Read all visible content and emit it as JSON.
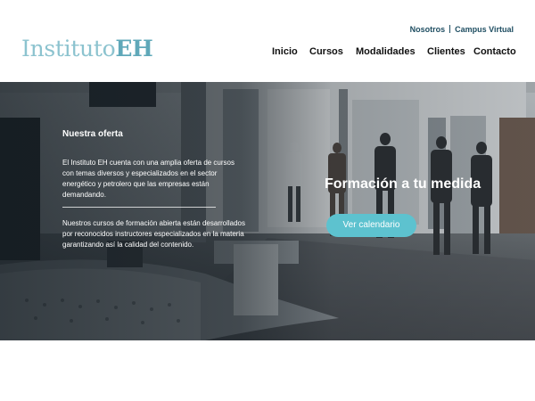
{
  "brand": {
    "logo_light": "Instituto",
    "logo_bold": "EH",
    "logo_color": "#8cc3cf",
    "logo_bold_color": "#5fa8b9"
  },
  "top_links": [
    {
      "label": "Nosotros"
    },
    {
      "label": "Campus Virtual"
    }
  ],
  "nav": {
    "items": [
      {
        "label": "Inicio"
      },
      {
        "label": "Cursos"
      },
      {
        "label": "Modalidades"
      },
      {
        "label": "Clientes"
      },
      {
        "label": "Contacto"
      }
    ]
  },
  "hero": {
    "section_title": "Nuestra oferta",
    "paragraph_1": "El Instituto EH cuenta con una amplia oferta de cursos con temas diversos y especializados en el sector energético y petrolero que las empresas están demandando.",
    "paragraph_2": "Nuestros cursos de formación abierta están desarrollados por reconocidos instructores especializados en la materia garantizando así la calidad del contenido.",
    "headline": "Formación a tu medida",
    "cta_label": "Ver calendario",
    "accent_color": "#5dc2cf",
    "background": "office-lobby-photo"
  }
}
